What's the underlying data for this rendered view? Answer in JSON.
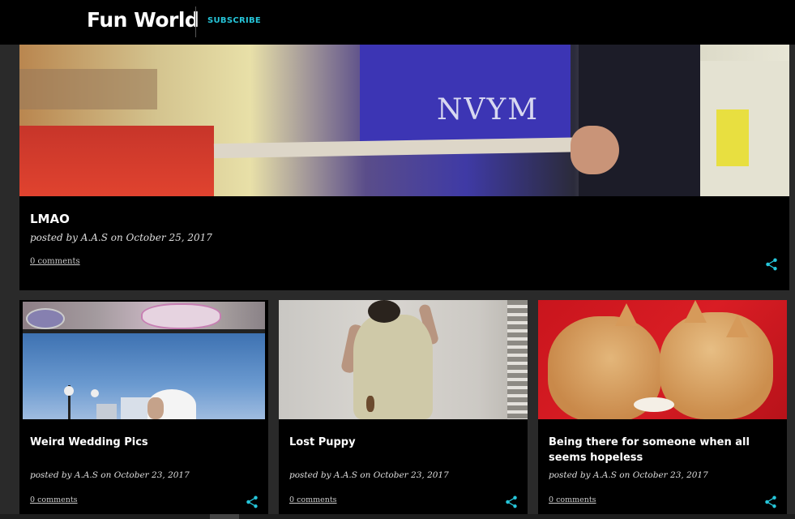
{
  "header": {
    "site_title": "Fun World",
    "subscribe_label": "SUBSCRIBE"
  },
  "featured_post": {
    "title": "LMAO",
    "byline": "posted by A.A.S on October 25, 2017",
    "comments": "0 comments",
    "image_text": "NVYM"
  },
  "posts": [
    {
      "title": "Weird Wedding Pics",
      "byline": "posted by A.A.S on October 23, 2017",
      "comments": "0 comments"
    },
    {
      "title": "Lost Puppy",
      "byline": "posted by A.A.S on October 23, 2017",
      "comments": "0 comments"
    },
    {
      "title": "Being there for someone when all seems hopeless",
      "byline": "posted by A.A.S on October 23, 2017",
      "comments": "0 comments"
    }
  ],
  "colors": {
    "accent": "#26c6da",
    "background": "#2a2a2a",
    "card_background": "#000000"
  },
  "icons": {
    "share": "share-icon"
  }
}
